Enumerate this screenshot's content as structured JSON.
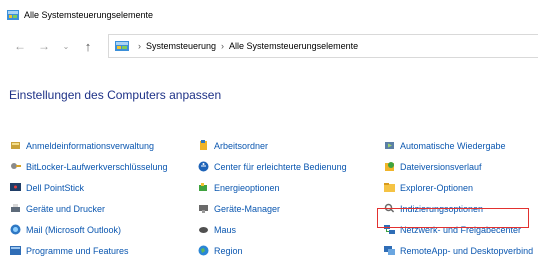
{
  "window": {
    "title": "Alle Systemsteuerungselemente"
  },
  "nav": {
    "back_icon": "arrow-left-icon",
    "forward_icon": "arrow-right-icon",
    "recent_icon": "chevron-down-icon",
    "up_icon": "arrow-up-icon"
  },
  "address": {
    "crumbs": [
      "Systemsteuerung",
      "Alle Systemsteuerungselemente"
    ]
  },
  "heading": "Einstellungen des Computers anpassen",
  "columns": [
    {
      "items": [
        {
          "label": "Anmeldeinformationsverwaltung",
          "icon": "credential-manager-icon"
        },
        {
          "label": "BitLocker-Laufwerkverschlüsselung",
          "icon": "bitlocker-icon"
        },
        {
          "label": "Dell PointStick",
          "icon": "pointstick-icon"
        },
        {
          "label": "Geräte und Drucker",
          "icon": "devices-printers-icon"
        },
        {
          "label": "Mail (Microsoft Outlook)",
          "icon": "mail-icon"
        },
        {
          "label": "Programme und Features",
          "icon": "programs-icon"
        }
      ]
    },
    {
      "items": [
        {
          "label": "Arbeitsordner",
          "icon": "work-folders-icon"
        },
        {
          "label": "Center für erleichterte Bedienung",
          "icon": "ease-of-access-icon"
        },
        {
          "label": "Energieoptionen",
          "icon": "power-options-icon"
        },
        {
          "label": "Geräte-Manager",
          "icon": "device-manager-icon"
        },
        {
          "label": "Maus",
          "icon": "mouse-icon"
        },
        {
          "label": "Region",
          "icon": "region-icon"
        }
      ]
    },
    {
      "items": [
        {
          "label": "Automatische Wiedergabe",
          "icon": "autoplay-icon"
        },
        {
          "label": "Dateiversionsverlauf",
          "icon": "file-history-icon"
        },
        {
          "label": "Explorer-Optionen",
          "icon": "explorer-options-icon"
        },
        {
          "label": "Indizierungsoptionen",
          "icon": "indexing-icon"
        },
        {
          "label": "Netzwerk- und Freigabecenter",
          "icon": "network-sharing-icon"
        },
        {
          "label": "RemoteApp- und Desktopverbind",
          "icon": "remoteapp-icon"
        }
      ]
    }
  ],
  "colors": {
    "link": "#0b57b0",
    "heading": "#1e3287",
    "highlight_border": "#e2312f"
  }
}
